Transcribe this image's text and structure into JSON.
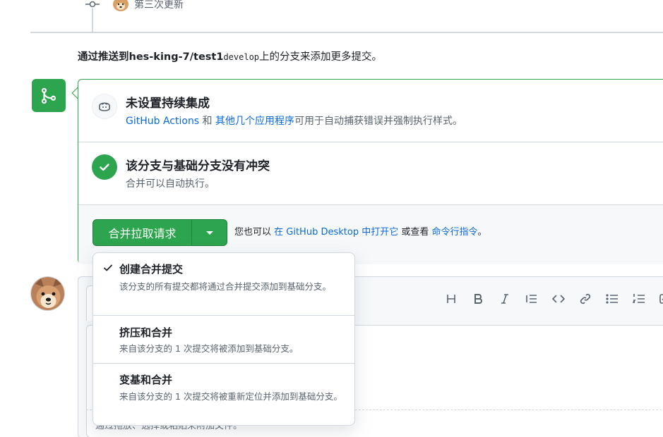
{
  "timeline": {
    "commit_message": "第三次更新"
  },
  "push_hint": {
    "prefix": "通过推送到",
    "repo": "hes-king-7/test1",
    "branch": "develop",
    "suffix": "上的分支来添加更多提交。"
  },
  "ci": {
    "title": "未设置持续集成",
    "link1": "GitHub Actions",
    "and": " 和 ",
    "link2": "其他几个应用程序",
    "desc": "可用于自动捕获错误并强制执行样式。"
  },
  "conflict": {
    "title": "该分支与基础分支没有冲突",
    "desc": "合并可以自动执行。"
  },
  "merge_action": {
    "button_label": "合并拉取请求",
    "alt_prefix": "您也可以 ",
    "desktop_link": "在 GitHub Desktop 中打开它",
    "alt_mid": " 或查看 ",
    "cli_link": "命令行指令",
    "alt_suffix": "。"
  },
  "merge_options": [
    {
      "title": "创建合并提交",
      "desc": "该分支的所有提交都将通过合并提交添加到基础分支。",
      "selected": true
    },
    {
      "title": "挤压和合并",
      "desc": "来自该分支的 1 次提交将被添加到基础分支。",
      "selected": false
    },
    {
      "title": "变基和合并",
      "desc": "来自该分支的 1 次提交将被重新定位并添加到基础分支。",
      "selected": false
    }
  ],
  "editor": {
    "toolbar": [
      "H",
      "B",
      "I",
      "quote",
      "code",
      "link",
      "bulleted-list",
      "numbered-list",
      "task-list"
    ],
    "hint": "通过拖放、选择或粘贴来附加文件。"
  },
  "colors": {
    "success": "#2da44e",
    "link": "#0969da",
    "muted": "#59636e",
    "border": "#d0d7de"
  }
}
